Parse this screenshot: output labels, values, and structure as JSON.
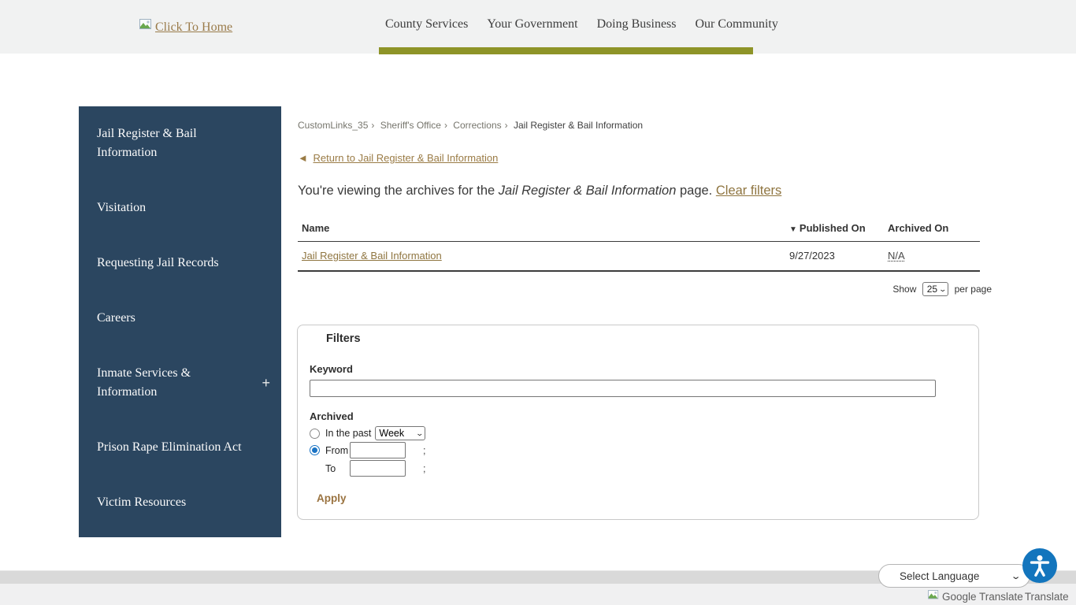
{
  "header": {
    "logo_text": "Click To Home",
    "nav_items": [
      "County Services",
      "Your Government",
      "Doing Business",
      "Our Community"
    ]
  },
  "sidebar": {
    "items": [
      {
        "label": "Jail Register & Bail Information"
      },
      {
        "label": "Visitation"
      },
      {
        "label": "Requesting Jail Records"
      },
      {
        "label": "Careers"
      },
      {
        "label": "Inmate Services & Information",
        "expander": "+"
      },
      {
        "label": "Prison Rape Elimination Act"
      },
      {
        "label": "Victim Resources"
      }
    ]
  },
  "breadcrumb": {
    "links": [
      "CustomLinks_35",
      "Sheriff's Office",
      "Corrections"
    ],
    "separator": "›",
    "current": "Jail Register & Bail Information"
  },
  "return_link": {
    "arrow": "◄",
    "label": "Return to Jail Register & Bail Information"
  },
  "archive_notice": {
    "prefix": "You're viewing the archives for the ",
    "page_name": "Jail Register & Bail Information",
    "suffix": " page. ",
    "clear_link": "Clear filters"
  },
  "table": {
    "sort_indicator": "▼",
    "headers": {
      "name": "Name",
      "published": "Published On",
      "archived": "Archived On"
    },
    "rows": [
      {
        "name": "Jail Register & Bail Information",
        "published_on": "9/27/2023",
        "archived_on": "N/A"
      }
    ]
  },
  "pagination": {
    "show_label": "Show",
    "selected": "25",
    "suffix": "per page",
    "caret": "⌄"
  },
  "filters": {
    "title": "Filters",
    "keyword_label": "Keyword",
    "keyword_value": "",
    "archived_label": "Archived",
    "in_the_past_label": "In the past",
    "period_selected": "Week",
    "period_caret": "⌄",
    "from_label": "From",
    "to_label": "To",
    "from_value": "",
    "to_value": "",
    "separator_char": ";",
    "apply_label": "Apply"
  },
  "footer": {
    "language_selector": "Select Language",
    "language_caret": "⌄",
    "translate_attribution": "Google Translate",
    "translate_label": "Translate"
  },
  "colors": {
    "accent_olive": "#8e9428",
    "sidebar_blue": "#2b4660",
    "link_brown": "#8f7540",
    "a11y_blue": "#1375bd",
    "radio_checked": "#1a73c4"
  }
}
